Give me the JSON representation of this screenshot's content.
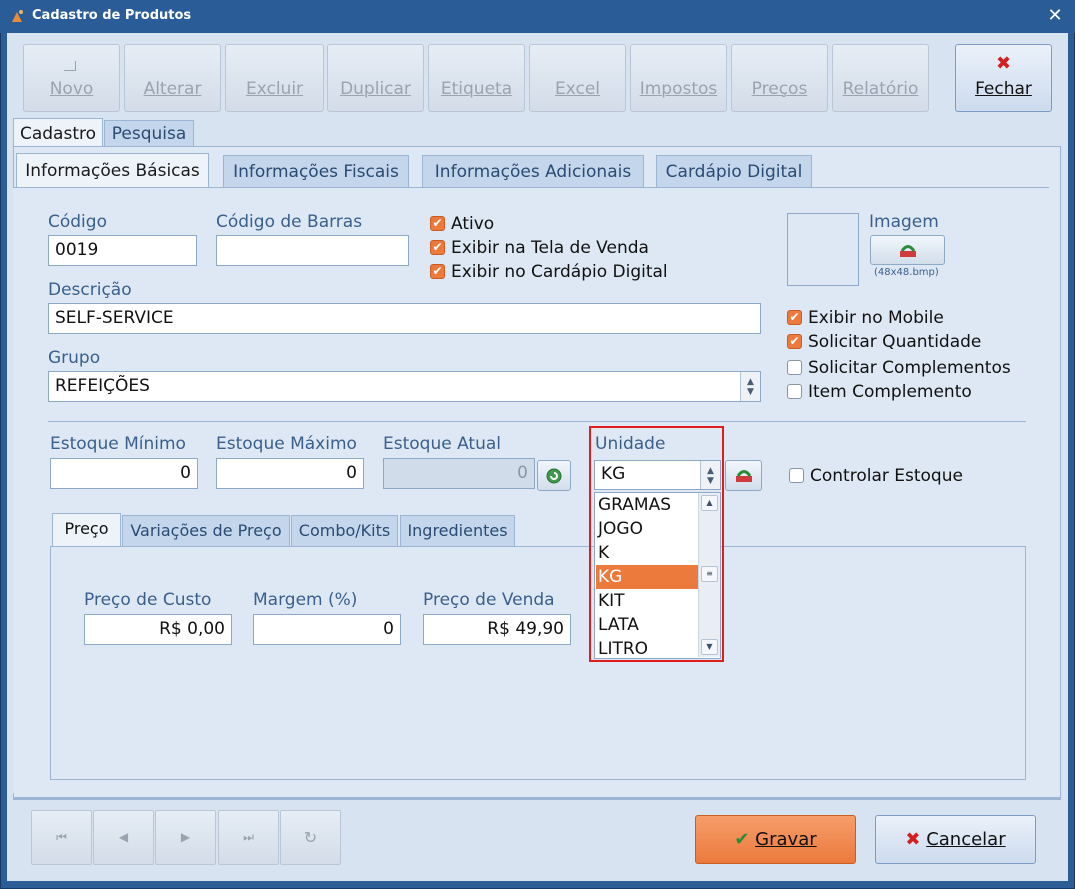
{
  "window": {
    "title": "Cadastro de Produtos",
    "close_glyph": "✕"
  },
  "toolbar": {
    "buttons": [
      "Novo",
      "Alterar",
      "Excluir",
      "Duplicar",
      "Etiqueta",
      "Excel",
      "Impostos",
      "Preços",
      "Relatório"
    ],
    "close_label": "Fechar",
    "close_icon": "x-icon"
  },
  "tabs": {
    "main": [
      "Cadastro",
      "Pesquisa"
    ],
    "sub": [
      "Informações Básicas",
      "Informações Fiscais",
      "Informações Adicionais",
      "Cardápio Digital"
    ]
  },
  "form": {
    "codigo_label": "Código",
    "codigo_value": "0019",
    "barras_label": "Código de Barras",
    "barras_value": "",
    "descricao_label": "Descrição",
    "descricao_value": "SELF-SERVICE",
    "grupo_label": "Grupo",
    "grupo_value": "REFEIÇÕES",
    "imagem_label": "Imagem",
    "imagem_hint": "(48x48.bmp)",
    "checks_top": [
      {
        "label": "Ativo",
        "checked": true
      },
      {
        "label": "Exibir na Tela de Venda",
        "checked": true
      },
      {
        "label": "Exibir no Cardápio Digital",
        "checked": true
      }
    ],
    "checks_right": [
      {
        "label": "Exibir no Mobile",
        "checked": true
      },
      {
        "label": "Solicitar Quantidade",
        "checked": true
      },
      {
        "label": "Solicitar Complementos",
        "checked": false
      },
      {
        "label": "Item Complemento",
        "checked": false
      }
    ],
    "estoque_min_label": "Estoque Mínimo",
    "estoque_min_value": "0",
    "estoque_max_label": "Estoque Máximo",
    "estoque_max_value": "0",
    "estoque_atual_label": "Estoque Atual",
    "estoque_atual_value": "0",
    "unidade_label": "Unidade",
    "unidade_value": "KG",
    "unidade_options": [
      "GRAMAS",
      "JOGO",
      "K",
      "KG",
      "KIT",
      "LATA",
      "LITRO"
    ],
    "unidade_selected_index": 3,
    "controlar_estoque_label": "Controlar Estoque",
    "controlar_estoque_checked": false
  },
  "price_tabs": [
    "Preço",
    "Variações de Preço",
    "Combo/Kits",
    "Ingredientes"
  ],
  "price": {
    "custo_label": "Preço de Custo",
    "custo_value": "R$ 0,00",
    "margem_label": "Margem (%)",
    "margem_value": "0",
    "venda_label": "Preço de Venda",
    "venda_value": "R$ 49,90"
  },
  "nav_glyphs": [
    "⏮",
    "◀",
    "▶",
    "⏭",
    "↻"
  ],
  "actions": {
    "gravar_label": "Gravar",
    "cancelar_label": "Cancelar",
    "check_glyph": "✔",
    "cross_glyph": "✖"
  },
  "colors": {
    "accent": "#ec7a3c",
    "highlight": "#e01d1d",
    "frame": "#2a5c97"
  }
}
